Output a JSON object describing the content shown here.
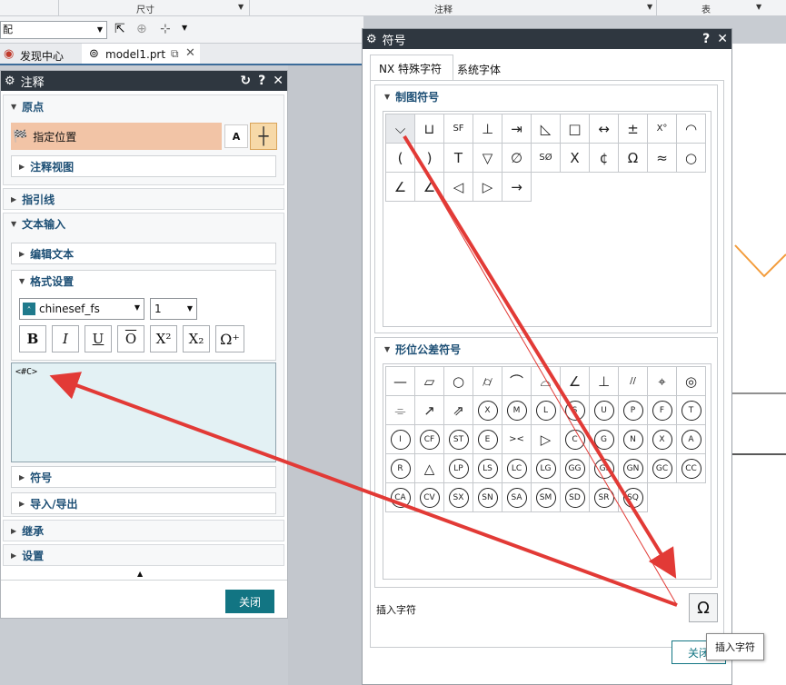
{
  "ribbon": {
    "group1": "尺寸",
    "group2": "注释",
    "group3": "表"
  },
  "toolbar": {
    "selector_value": "配"
  },
  "tabs": {
    "home": "发现中心",
    "file": "model1.prt"
  },
  "annotation_dialog": {
    "title": "注释",
    "origin": {
      "label": "原点",
      "specify_location": "指定位置",
      "annotation_view": "注释视图"
    },
    "leader": "指引线",
    "text_input": {
      "label": "文本输入",
      "edit_text": "编辑文本",
      "format_settings": "格式设置",
      "font_value": "chinesef_fs",
      "size_value": "1",
      "format_buttons": [
        "B",
        "I",
        "U",
        "O",
        "X²",
        "X₂"
      ],
      "text_content": "<#C>",
      "symbols": "符号",
      "import_export": "导入/导出"
    },
    "inherit": "继承",
    "settings": "设置",
    "close": "关闭"
  },
  "symbol_dialog": {
    "title": "符号",
    "tabs": [
      "NX 特殊字符",
      "系统字体"
    ],
    "drafting_symbols": {
      "label": "制图符号",
      "items": [
        "⌵",
        "⊔",
        "SF",
        "⊥",
        "⇥",
        "◺",
        "□",
        "↔",
        "±",
        "X°",
        "◠",
        "(",
        ")",
        "T",
        "▽",
        "∅",
        "SØ",
        "X",
        "¢",
        "Ω",
        "≈",
        "○",
        "∠",
        "∠",
        "◁",
        "▷",
        "→"
      ]
    },
    "gdt_symbols": {
      "label": "形位公差符号",
      "items": [
        "—",
        "▱",
        "○",
        "⌭",
        "⌒",
        "⌓",
        "∠",
        "⊥",
        "//",
        "⌖",
        "◎",
        "⌯",
        "↗",
        "⇗",
        "X",
        "M",
        "L",
        "S",
        "U",
        "P",
        "F",
        "T",
        "I",
        "CF",
        "ST",
        "E",
        "><",
        "▷",
        "C",
        "G",
        "N",
        "X",
        "A",
        "R",
        "△",
        "LP",
        "LS",
        "LC",
        "LG",
        "GG",
        "GI",
        "GN",
        "GC",
        "CC",
        "CA",
        "CV",
        "SX",
        "SN",
        "SA",
        "SM",
        "SD",
        "SR",
        "SQ"
      ]
    },
    "insert_label": "插入字符",
    "insert_tooltip": "插入字符",
    "close": "关闭"
  },
  "colors": {
    "title_bar": "#2f3740",
    "accent": "#127583",
    "section_text": "#1d4f75",
    "selected_row": "#f2c4a6",
    "text_area": "#e3f1f4",
    "arrow": "#e23a36"
  }
}
